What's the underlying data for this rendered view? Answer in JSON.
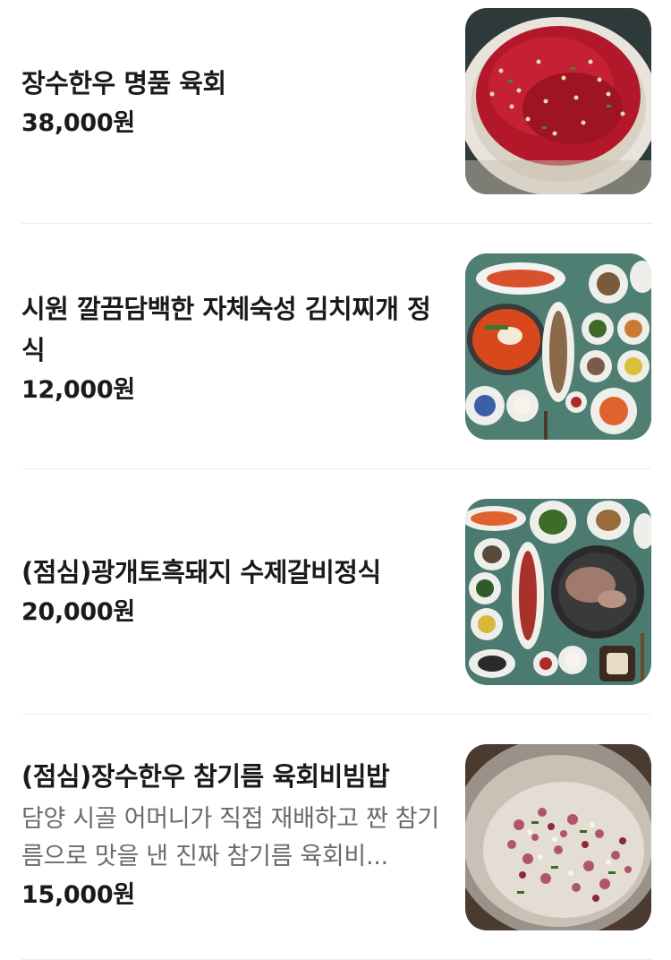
{
  "menu": {
    "items": [
      {
        "name": "장수한우 명품 육회",
        "description": "",
        "price": "38,000원",
        "image": "beef-tartare-photo"
      },
      {
        "name": "시원 깔끔담백한 자체숙성 김치찌개 정식",
        "description": "",
        "price": "12,000원",
        "image": "kimchi-stew-set-photo"
      },
      {
        "name": "(점심)광개토흑돼지 수제갈비정식",
        "description": "",
        "price": "20,000원",
        "image": "black-pork-galbi-set-photo"
      },
      {
        "name": "(점심)장수한우 참기름 육회비빔밥",
        "description": "담양 시골 어머니가 직접 재배하고 짠 참기름으로 맛을 낸 진짜 참기름 육회비...",
        "price": "15,000원",
        "image": "yukhoe-bibimbap-photo"
      }
    ]
  },
  "colors": {
    "text_primary": "#1a1a1a",
    "text_secondary": "#6b6b6b",
    "divider": "#ececec"
  }
}
